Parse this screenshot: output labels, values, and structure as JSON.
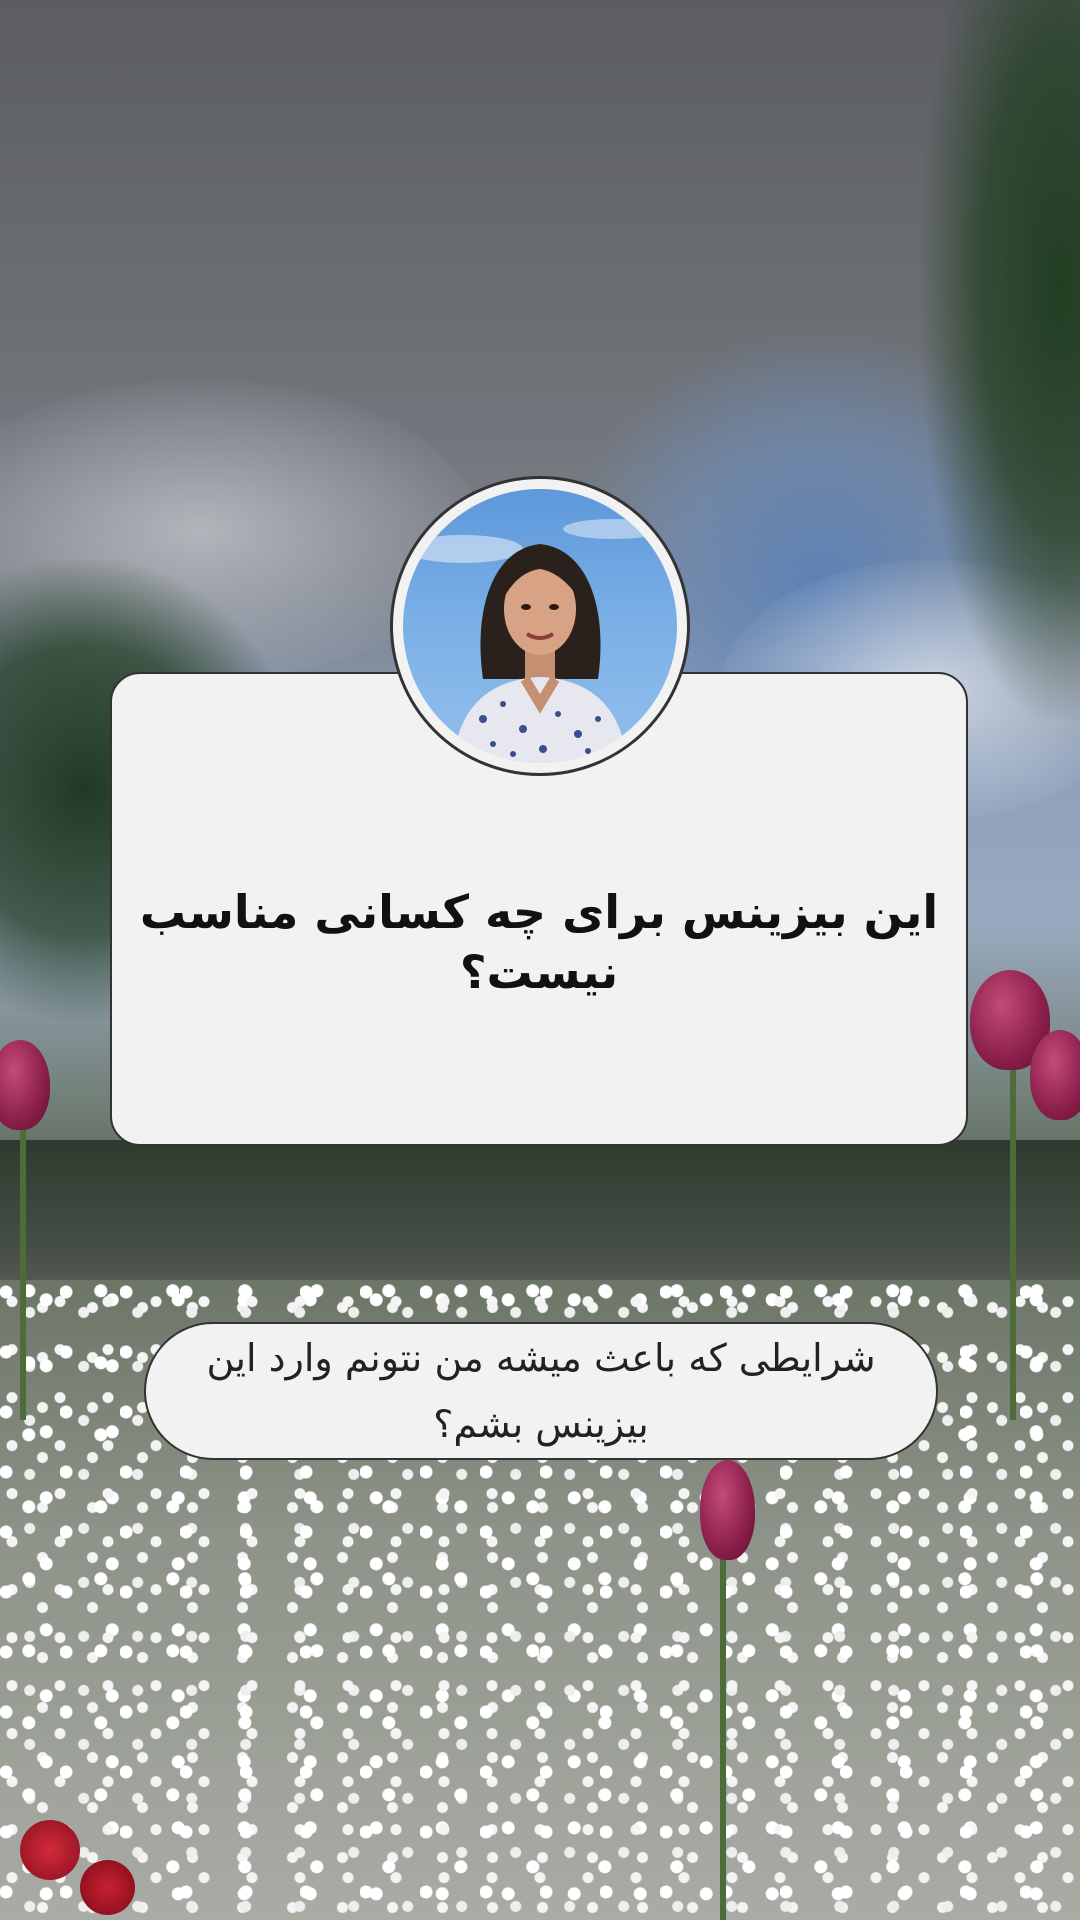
{
  "title_card": {
    "title": "این بیزینس برای چه کسانی مناسب نیست؟"
  },
  "subtitle_pill": {
    "text": "شرایطی که باعث میشه من نتونم وارد این بیزینس بشم؟"
  },
  "colors": {
    "card_background": "#f2f2f2",
    "card_border": "#333333",
    "title_text": "#111111",
    "subtitle_text": "#222222"
  }
}
